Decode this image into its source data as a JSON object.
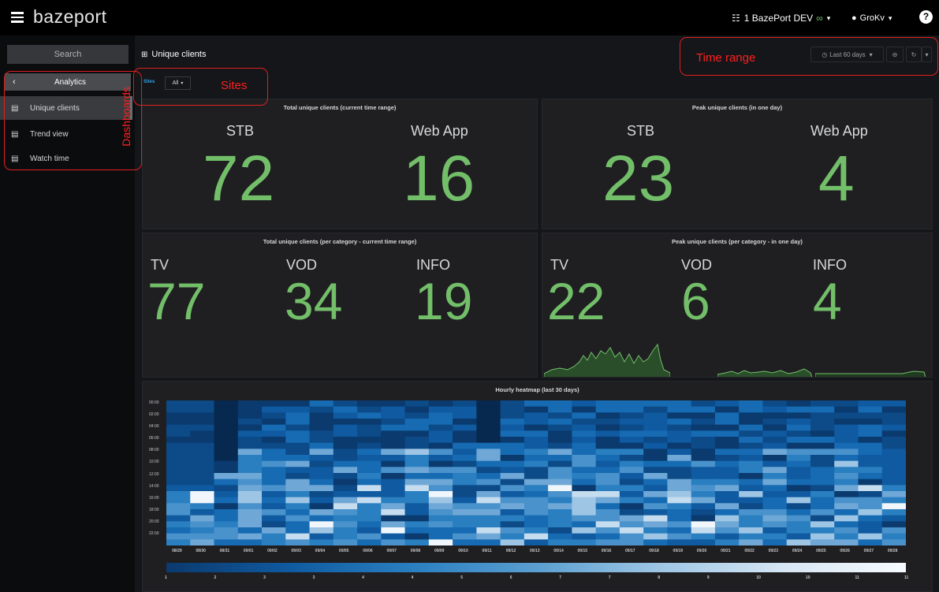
{
  "topbar": {
    "logo": "bazeport",
    "org": "1 BazePort DEV",
    "user": "GroKv"
  },
  "sidebar": {
    "search_placeholder": "Search",
    "section": "Analytics",
    "items": [
      {
        "label": "Unique clients",
        "active": true
      },
      {
        "label": "Trend view",
        "active": false
      },
      {
        "label": "Watch time",
        "active": false
      }
    ]
  },
  "header": {
    "title": "Unique clients",
    "sites_label": "Sites",
    "sites_value": "All",
    "time_range": "Last 60 days"
  },
  "annotations": {
    "dashboards": "Dashboards",
    "sites": "Sites",
    "time_range": "Time range"
  },
  "panels": {
    "total": {
      "title": "Total unique clients (current time range)",
      "labels": [
        "STB",
        "Web App"
      ],
      "values": [
        "72",
        "16"
      ]
    },
    "peak": {
      "title": "Peak unique clients (in one day)",
      "labels": [
        "STB",
        "Web App"
      ],
      "values": [
        "23",
        "4"
      ]
    },
    "total_cat": {
      "title": "Total unique clients (per category - current time range)",
      "labels": [
        "TV",
        "VOD",
        "INFO"
      ],
      "values": [
        "77",
        "34",
        "19"
      ]
    },
    "peak_cat": {
      "title": "Peak unique clients (per category - in one day)",
      "labels": [
        "TV",
        "VOD",
        "INFO"
      ],
      "values": [
        "22",
        "6",
        "4"
      ]
    }
  },
  "heatmap": {
    "title": "Hourly heatmap (last 30 days)",
    "hours": [
      "00:00",
      "02:00",
      "04:00",
      "06:00",
      "08:00",
      "10:00",
      "12:00",
      "14:00",
      "16:00",
      "18:00",
      "20:00",
      "22:00"
    ],
    "dates": [
      "08/29",
      "08/30",
      "08/31",
      "09/01",
      "09/02",
      "09/03",
      "09/04",
      "09/05",
      "09/06",
      "09/07",
      "09/08",
      "09/09",
      "09/10",
      "09/11",
      "09/12",
      "09/13",
      "09/14",
      "09/15",
      "09/16",
      "09/17",
      "09/18",
      "09/19",
      "09/20",
      "09/21",
      "09/22",
      "09/23",
      "09/24",
      "09/25",
      "09/26",
      "09/27",
      "09/28"
    ],
    "scale_ticks": [
      "1",
      "2",
      "3",
      "3",
      "4",
      "4",
      "5",
      "6",
      "7",
      "7",
      "8",
      "9",
      "10",
      "10",
      "11",
      "11"
    ]
  },
  "colors": {
    "value_green": "#73bf69",
    "annotation_red": "#e02020",
    "heat_low": "#08306b",
    "heat_high": "#f7fbff"
  }
}
